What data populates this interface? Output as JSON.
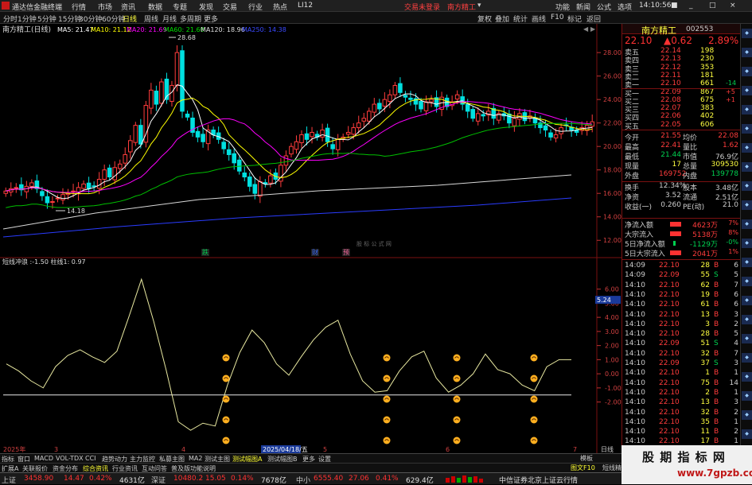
{
  "app": {
    "title": "通达信金融终端",
    "menu": [
      "行情",
      "市场",
      "资讯",
      "数据",
      "专题",
      "发现",
      "交易",
      "行业",
      "热点",
      "LI12"
    ],
    "notice": "交易未登录",
    "stock_label": "南方精工",
    "win_btns": [
      "功能",
      "新闻",
      "公式",
      "选项"
    ],
    "time": "14:10:56",
    "window_controls": [
      "■",
      "_",
      "□",
      "×"
    ]
  },
  "toolbar": {
    "periods": [
      "分时",
      "1分钟",
      "5分钟",
      "15分钟",
      "30分钟",
      "60分钟",
      "日线",
      "周线",
      "月线",
      "多周期",
      "更多"
    ],
    "right": [
      "复权",
      "叠加",
      "统计",
      "画线",
      "F10",
      "标记",
      "返回"
    ]
  },
  "chart": {
    "title": "南方精工(日线)",
    "ma_labels": [
      {
        "t": "MA5: 21.47",
        "c": "#ffffff"
      },
      {
        "t": "MA10: 21.12",
        "c": "#ffff00"
      },
      {
        "t": "MA20: 21.69",
        "c": "#ff00ff"
      },
      {
        "t": "MA60: 21.60",
        "c": "#00e000"
      },
      {
        "t": "MA120: 18.96",
        "c": "#e0e0e0"
      },
      {
        "t": "MA250: 14.38",
        "c": "#3a4aff"
      }
    ],
    "high_mark": "28.68",
    "low_mark": "14.18",
    "watermark": "股 标 公 式 网",
    "price_axis": [
      "28.00",
      "26.00",
      "24.00",
      "22.00",
      "20.00",
      "18.00",
      "16.00",
      "14.00",
      "12.00"
    ],
    "markers": [
      {
        "t": "跌",
        "c": "#00d050"
      },
      {
        "t": "财",
        "c": "#3a6aff"
      },
      {
        "t": "预",
        "c": "#ff6aa0"
      }
    ],
    "ind_title": "短线冲浪 :-1.50 柱线1: 0.97",
    "ind_axis": [
      "6.00",
      "5.00",
      "4.00",
      "3.00",
      "2.00",
      "1.00",
      "0.00",
      "-1.00",
      "-2.00"
    ],
    "ind_tag": "5.24",
    "dates": [
      "2025年",
      "3",
      "4",
      "2025/04/18/五",
      "5",
      "6",
      "7"
    ],
    "date_right": "日线",
    "icons": [
      "sun-icon"
    ]
  },
  "chart_data": {
    "type": "line",
    "price_series": {
      "name": "K线",
      "range": [
        11,
        29.5
      ]
    },
    "indicator": {
      "name": "短线冲浪",
      "values": [
        0.7,
        0.2,
        -0.5,
        -1.0,
        0.5,
        1.3,
        1.7,
        1.2,
        0.8,
        1.6,
        4.1,
        6.7,
        3.7,
        0.3,
        -3.4,
        -4.0,
        -3.5,
        -3.7,
        -0.8,
        1.5,
        3.1,
        2.2,
        0.7,
        -0.1,
        1.2,
        2.4,
        3.3,
        3.8,
        1.4,
        -0.5,
        -1.3,
        -1.2,
        0.2,
        1.2,
        1.6,
        -0.3,
        -1.3,
        -0.8,
        0.0,
        1.4,
        0.3,
        0.0,
        -0.8,
        -1.2,
        0.5,
        1.0,
        1.0
      ],
      "range": [
        -4.5,
        7.5
      ],
      "threshold": -1.5
    }
  },
  "quote": {
    "name": "南方精工",
    "code": "002553",
    "price": "22.10",
    "change": "▲0.62",
    "pct": "2.89%",
    "book": [
      {
        "l": "卖五",
        "p": "22.14",
        "v": "198",
        "d": ""
      },
      {
        "l": "卖四",
        "p": "22.13",
        "v": "230",
        "d": ""
      },
      {
        "l": "卖三",
        "p": "22.12",
        "v": "353",
        "d": ""
      },
      {
        "l": "卖二",
        "p": "22.11",
        "v": "181",
        "d": ""
      },
      {
        "l": "卖一",
        "p": "22.10",
        "v": "661",
        "d": "-14"
      },
      {
        "l": "买一",
        "p": "22.09",
        "v": "867",
        "d": "+5"
      },
      {
        "l": "买二",
        "p": "22.08",
        "v": "675",
        "d": "+1"
      },
      {
        "l": "买三",
        "p": "22.07",
        "v": "383",
        "d": ""
      },
      {
        "l": "买四",
        "p": "22.06",
        "v": "402",
        "d": ""
      },
      {
        "l": "买五",
        "p": "22.05",
        "v": "606",
        "d": ""
      }
    ],
    "stats": [
      [
        "今开",
        "21.55",
        "均价",
        "22.08"
      ],
      [
        "最高",
        "22.41",
        "量比",
        "1.62"
      ],
      [
        "最低",
        "21.44",
        "市值",
        "76.9亿"
      ],
      [
        "现量",
        "17",
        "总量",
        "309530"
      ],
      [
        "外盘",
        "169752",
        "内盘",
        "139778"
      ],
      [
        "换手",
        "12.34%",
        "股本",
        "3.48亿"
      ],
      [
        "净资",
        "3.52",
        "流通",
        "2.51亿"
      ],
      [
        "收益(一)",
        "0.260",
        "PE(动)",
        "21.0"
      ]
    ],
    "flows": [
      {
        "l": "净流入额",
        "v": "4623万",
        "p": "7%"
      },
      {
        "l": "大宗流入",
        "v": "5138万",
        "p": "8%"
      },
      {
        "l": "5日净流入额",
        "v": "-1129万",
        "p": "-0%"
      },
      {
        "l": "5日大宗流入",
        "v": "2041万",
        "p": "1%"
      }
    ],
    "ticks": [
      [
        "14:09",
        "22.10",
        "28",
        "B",
        "6"
      ],
      [
        "14:09",
        "22.09",
        "55",
        "S",
        "5"
      ],
      [
        "14:10",
        "22.10",
        "62",
        "B",
        "7"
      ],
      [
        "14:10",
        "22.10",
        "19",
        "B",
        "6"
      ],
      [
        "14:10",
        "22.10",
        "61",
        "B",
        "6"
      ],
      [
        "14:10",
        "22.10",
        "13",
        "B",
        "3"
      ],
      [
        "14:10",
        "22.10",
        "3",
        "B",
        "2"
      ],
      [
        "14:10",
        "22.10",
        "28",
        "B",
        "5"
      ],
      [
        "14:10",
        "22.09",
        "51",
        "S",
        "4"
      ],
      [
        "14:10",
        "22.10",
        "32",
        "B",
        "7"
      ],
      [
        "14:10",
        "22.09",
        "37",
        "S",
        "3"
      ],
      [
        "14:10",
        "22.10",
        "1",
        "B",
        "1"
      ],
      [
        "14:10",
        "22.10",
        "75",
        "B",
        "14"
      ],
      [
        "14:10",
        "22.10",
        "2",
        "B",
        "1"
      ],
      [
        "14:10",
        "22.10",
        "13",
        "B",
        "3"
      ],
      [
        "14:10",
        "22.10",
        "32",
        "B",
        "2"
      ],
      [
        "14:10",
        "22.10",
        "35",
        "B",
        "1"
      ],
      [
        "14:10",
        "22.10",
        "11",
        "B",
        "2"
      ],
      [
        "14:10",
        "22.10",
        "17",
        "B",
        "1"
      ]
    ]
  },
  "bottom_tabs": [
    "指标",
    "窗口",
    "MACD",
    "VOL-TDX",
    "CCI",
    "趋势动力",
    "主力监控",
    "私募主图",
    "MA2",
    "测试主图",
    "测试幅图A",
    "测试幅图B",
    "更多",
    "设置"
  ],
  "bottom_tabs2": [
    "扩展A",
    "关联报价",
    "资金分布",
    "综合资讯",
    "行业资讯",
    "互动问答",
    "普及版功能说明"
  ],
  "right_tabs": [
    "模板",
    "图文F10",
    "短线精灵"
  ],
  "status": {
    "sh": "上证",
    "shv": "3458.90",
    "shc": "14.47",
    "shp": "0.42%",
    "sha": "4631亿",
    "sz": "深证",
    "szv": "10480.2",
    "szc": "15.05",
    "szp": "0.14%",
    "sza": "7678亿",
    "zx": "中小",
    "zxv": "6555.40",
    "zxc": "27.06",
    "zxp": "0.41%",
    "zxa": "629.4亿",
    "broker": "中信证券北京上证云行情"
  },
  "watermark_site": "股 期 指 标 网",
  "watermark_url": "www.7gpzb.com"
}
